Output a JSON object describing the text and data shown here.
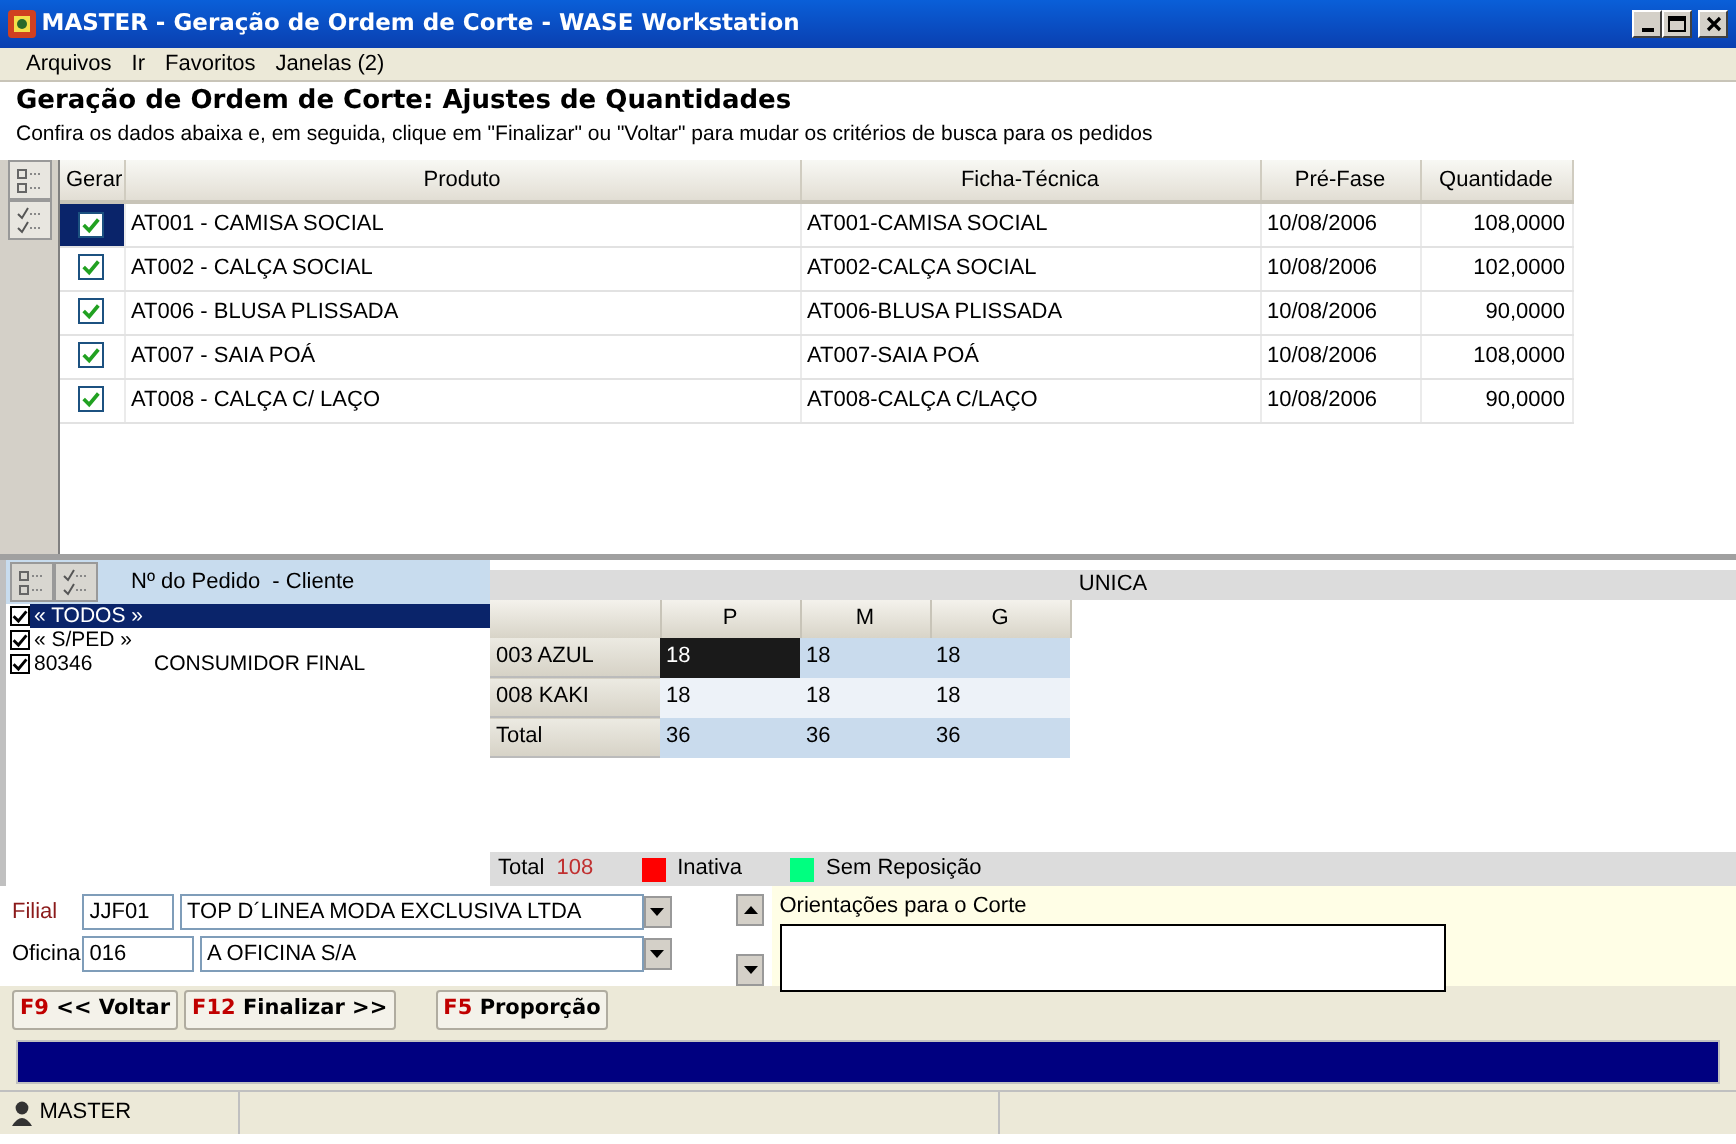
{
  "window": {
    "title": "MASTER - Geração de Ordem de Corte - WASE Workstation"
  },
  "menu": [
    "Arquivos",
    "Ir",
    "Favoritos",
    "Janelas (2)"
  ],
  "heading": "Geração de Ordem de Corte: Ajustes de Quantidades",
  "instructions": "Confira os dados abaixa e, em seguida, clique em \"Finalizar\" ou \"Voltar\" para mudar os critérios de busca para os pedidos",
  "products": {
    "columns": [
      "Gerar",
      "Produto",
      "Ficha-Técnica",
      "Pré-Fase",
      "Quantidade"
    ],
    "rows": [
      {
        "checked": true,
        "selected": true,
        "produto": "AT001 - CAMISA SOCIAL",
        "ficha": "AT001-CAMISA SOCIAL",
        "pre_fase": "10/08/2006",
        "quantidade": "108,0000"
      },
      {
        "checked": true,
        "selected": false,
        "produto": "AT002 - CALÇA SOCIAL",
        "ficha": "AT002-CALÇA SOCIAL",
        "pre_fase": "10/08/2006",
        "quantidade": "102,0000"
      },
      {
        "checked": true,
        "selected": false,
        "produto": "AT006 - BLUSA PLISSADA",
        "ficha": "AT006-BLUSA PLISSADA",
        "pre_fase": "10/08/2006",
        "quantidade": "90,0000"
      },
      {
        "checked": true,
        "selected": false,
        "produto": "AT007 - SAIA POÁ",
        "ficha": "AT007-SAIA POÁ",
        "pre_fase": "10/08/2006",
        "quantidade": "108,0000"
      },
      {
        "checked": true,
        "selected": false,
        "produto": "AT008 - CALÇA C/ LAÇO",
        "ficha": "AT008-CALÇA C/LAÇO",
        "pre_fase": "10/08/2006",
        "quantidade": "90,0000"
      }
    ]
  },
  "orders": {
    "header": "Nº do Pedido  - Cliente",
    "items": [
      {
        "checked": true,
        "selected": true,
        "pedido": "« TODOS »"
      },
      {
        "checked": true,
        "selected": false,
        "pedido": "« S/PED »"
      },
      {
        "checked": true,
        "selected": false,
        "pedido": "80346",
        "cliente": "CONSUMIDOR FINAL"
      }
    ]
  },
  "grade": {
    "title": "UNICA",
    "columns": [
      "P",
      "M",
      "G"
    ],
    "rows": [
      {
        "label": "003 AZUL",
        "cells": [
          {
            "value": "18",
            "selected": true
          },
          {
            "value": "18",
            "selected": false
          },
          {
            "value": "18",
            "selected": false
          }
        ]
      },
      {
        "label": "008 KAKI",
        "cells": [
          {
            "value": "18",
            "selected": false
          },
          {
            "value": "18",
            "selected": false
          },
          {
            "value": "18",
            "selected": false
          }
        ]
      },
      {
        "label": "Total",
        "cells": [
          {
            "value": "36",
            "selected": false
          },
          {
            "value": "36",
            "selected": false
          },
          {
            "value": "36",
            "selected": false
          }
        ]
      }
    ]
  },
  "summary": {
    "label": "Total",
    "value": "108"
  },
  "legend": [
    {
      "label": "Inativa",
      "color": "#ff0000"
    },
    {
      "label": "Sem Reposição",
      "color": "#00ff80"
    }
  ],
  "filial": {
    "label": "Filial",
    "code": "JJF01",
    "name": "TOP D´LINEA MODA EXCLUSIVA LTDA"
  },
  "oficina": {
    "label": "Oficina",
    "code": "016",
    "name": "A OFICINA S/A"
  },
  "notes": {
    "label": "Orientações para o Corte"
  },
  "buttons": [
    {
      "key": "F9",
      "label": "<< Voltar"
    },
    {
      "key": "F12",
      "label": "Finalizar >>"
    },
    {
      "key": "F5",
      "label": "Proporção"
    }
  ],
  "progress": {
    "level": 1
  },
  "status_bar": {
    "user": "MASTER"
  }
}
